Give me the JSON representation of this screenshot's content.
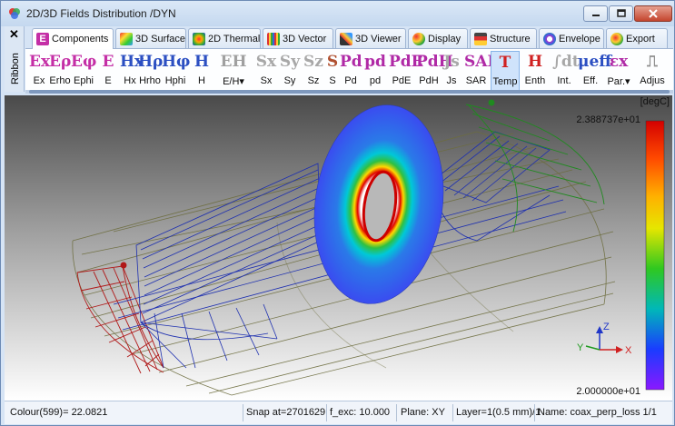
{
  "window": {
    "title": "2D/3D Fields Distribution /DYN"
  },
  "ribbon": {
    "side_label": "Ribbon",
    "close_glyph": "✕",
    "tabs": [
      {
        "label": "Components",
        "icon": "e-field-icon"
      },
      {
        "label": "3D Surface",
        "icon": "surface-3d-icon"
      },
      {
        "label": "2D Thermal",
        "icon": "thermal-2d-icon"
      },
      {
        "label": "3D Vector",
        "icon": "vector-3d-icon"
      },
      {
        "label": "3D Viewer",
        "icon": "viewer-3d-icon"
      },
      {
        "label": "Display",
        "icon": "display-icon"
      },
      {
        "label": "Structure",
        "icon": "structure-icon"
      },
      {
        "label": "Envelope",
        "icon": "envelope-icon"
      },
      {
        "label": "Export",
        "icon": "export-icon"
      }
    ],
    "tools": [
      {
        "glyph": "Ex",
        "label": "Ex",
        "color": "#c42fa6"
      },
      {
        "glyph": "Eρ",
        "label": "Erho",
        "color": "#c42fa6"
      },
      {
        "glyph": "Eφ",
        "label": "Ephi",
        "color": "#c42fa6"
      },
      {
        "glyph": "E",
        "label": "E",
        "color": "#c42fa6"
      },
      {
        "glyph": "Hx",
        "label": "Hx",
        "color": "#2c4fc2"
      },
      {
        "glyph": "Hρ",
        "label": "Hrho",
        "color": "#2c4fc2"
      },
      {
        "glyph": "Hφ",
        "label": "Hphi",
        "color": "#2c4fc2"
      },
      {
        "glyph": "H",
        "label": "H",
        "color": "#2c4fc2"
      },
      {
        "glyph": "EH",
        "label": "E/H▾",
        "color": "#a0a0a0"
      },
      {
        "glyph": "Sx",
        "label": "Sx",
        "color": "#a8a8a8"
      },
      {
        "glyph": "Sy",
        "label": "Sy",
        "color": "#a8a8a8"
      },
      {
        "glyph": "Sz",
        "label": "Sz",
        "color": "#a8a8a8"
      },
      {
        "glyph": "S",
        "label": "S",
        "color": "#b05030"
      },
      {
        "glyph": "Pd",
        "label": "Pd",
        "color": "#b02aa6"
      },
      {
        "glyph": "pd",
        "label": "pd",
        "color": "#b02aa6"
      },
      {
        "glyph": "PdE",
        "label": "PdE",
        "color": "#b02aa6"
      },
      {
        "glyph": "PdH",
        "label": "PdH",
        "color": "#b02aa6"
      },
      {
        "glyph": "Js",
        "label": "Js",
        "color": "#a8a8a8"
      },
      {
        "glyph": "SAR",
        "label": "SAR",
        "color": "#b02aa6"
      },
      {
        "glyph": "T",
        "label": "Temp",
        "color": "#d02020"
      },
      {
        "glyph": "H",
        "label": "Enth",
        "color": "#d02020"
      },
      {
        "glyph": "∫dt",
        "label": "Int.",
        "color": "#a8a8a8"
      },
      {
        "glyph": "μeff",
        "label": "Eff.",
        "color": "#2c4fc2"
      },
      {
        "glyph": "εx",
        "label": "Par.▾",
        "color": "#b02aa6"
      },
      {
        "glyph": "⎍",
        "label": "Adjus",
        "color": "#909090"
      }
    ]
  },
  "colorbar": {
    "unit": "[degC]",
    "max_label": "2.388737e+01",
    "min_label": "2.000000e+01"
  },
  "axes_triad": {
    "x": "X",
    "y": "Y",
    "z": "Z"
  },
  "status": {
    "colour": "Colour(599)= 22.0821",
    "snap": "Snap at=2701629",
    "f_exc": "f_exc: 10.000",
    "plane": "Plane: XY",
    "layer": "Layer=1(0.5 mm)/1",
    "name": "Name: coax_perp_loss 1/1"
  },
  "colors": {
    "wire_olive": "#7a7a44",
    "wire_blue": "#1d2fb0",
    "wire_red": "#b01818",
    "wire_green": "#1f8a1f",
    "accent_selected": "#cfe3fb"
  }
}
